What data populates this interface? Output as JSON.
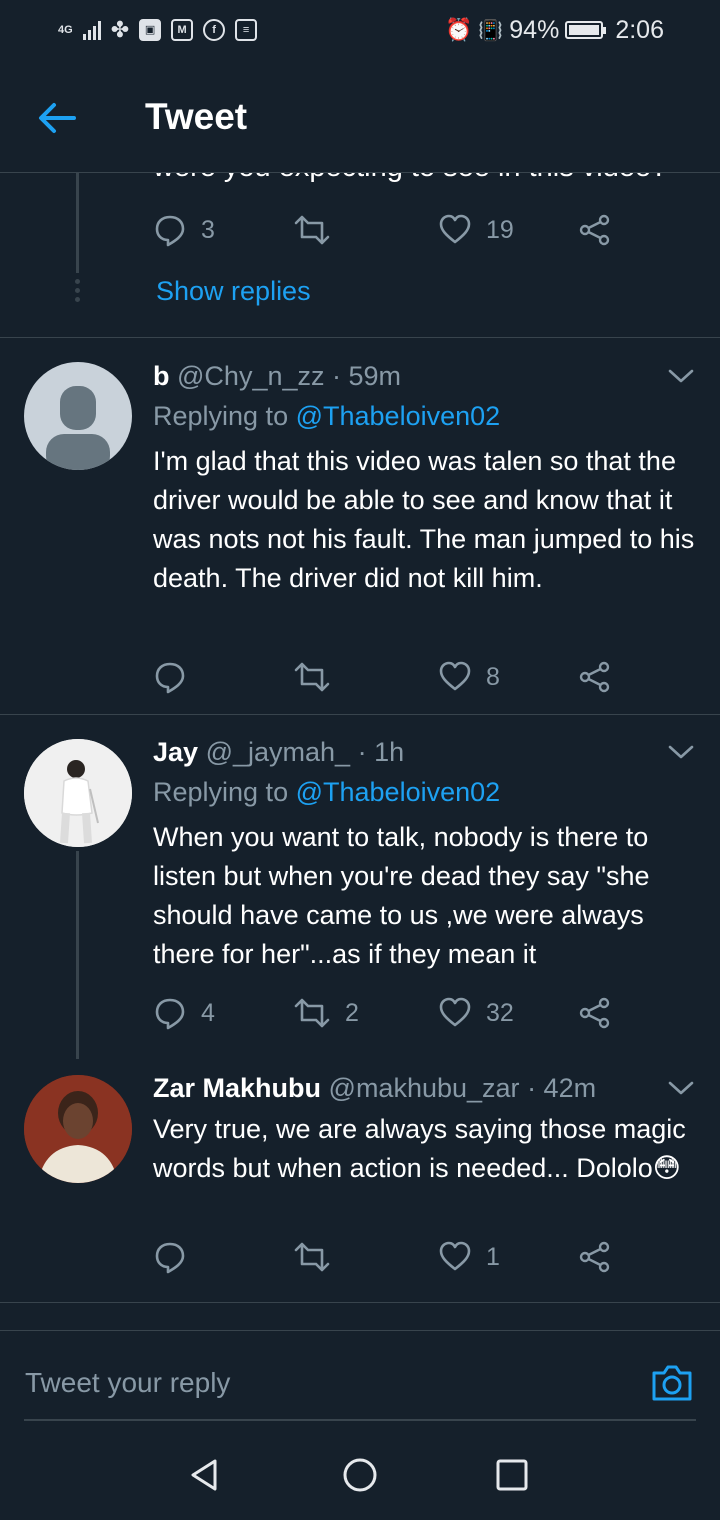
{
  "status_bar": {
    "network": "4G",
    "battery": "94%",
    "time": "2:06"
  },
  "header": {
    "title": "Tweet"
  },
  "previous": {
    "partial_text": "were you expecting to see in this video?",
    "replies": "3",
    "likes": "19",
    "show_replies": "Show replies"
  },
  "tweets": [
    {
      "name": "b",
      "handle": "@Chy_n_zz",
      "time": "· 59m",
      "replying_label": "Replying to",
      "replying_to": "@Thabeloiven02",
      "text": "I'm glad that this video was talen so that the driver would be able to see and know that it was nots not his fault. The man jumped to his death. The driver did not kill him.",
      "replies": "",
      "retweets": "",
      "likes": "8"
    },
    {
      "name": "Jay",
      "handle": "@_jaymah_",
      "time": "· 1h",
      "replying_label": "Replying to",
      "replying_to": "@Thabeloiven02",
      "text": "When you want to talk, nobody is there to listen but when you're dead they say \"she should have came to us ,we were always there for her\"...as if they mean it",
      "replies": "4",
      "retweets": "2",
      "likes": "32"
    },
    {
      "name": "Zar Makhubu",
      "handle": "@makhubu_zar",
      "time": "· 42m",
      "text": "Very true, we are always saying those magic words but when action is needed... Dololo😳",
      "replies": "",
      "retweets": "",
      "likes": "1"
    }
  ],
  "compose": {
    "placeholder": "Tweet your reply"
  },
  "icons": {
    "back": "arrow-left-icon",
    "reply": "speech-bubble-icon",
    "retweet": "retweet-icon",
    "like": "heart-icon",
    "share": "share-icon",
    "more": "chevron-down-icon",
    "camera": "camera-icon"
  },
  "colors": {
    "background": "#15202b",
    "accent": "#1da1f2",
    "secondary_text": "#8899a6",
    "divider": "#38444d"
  }
}
